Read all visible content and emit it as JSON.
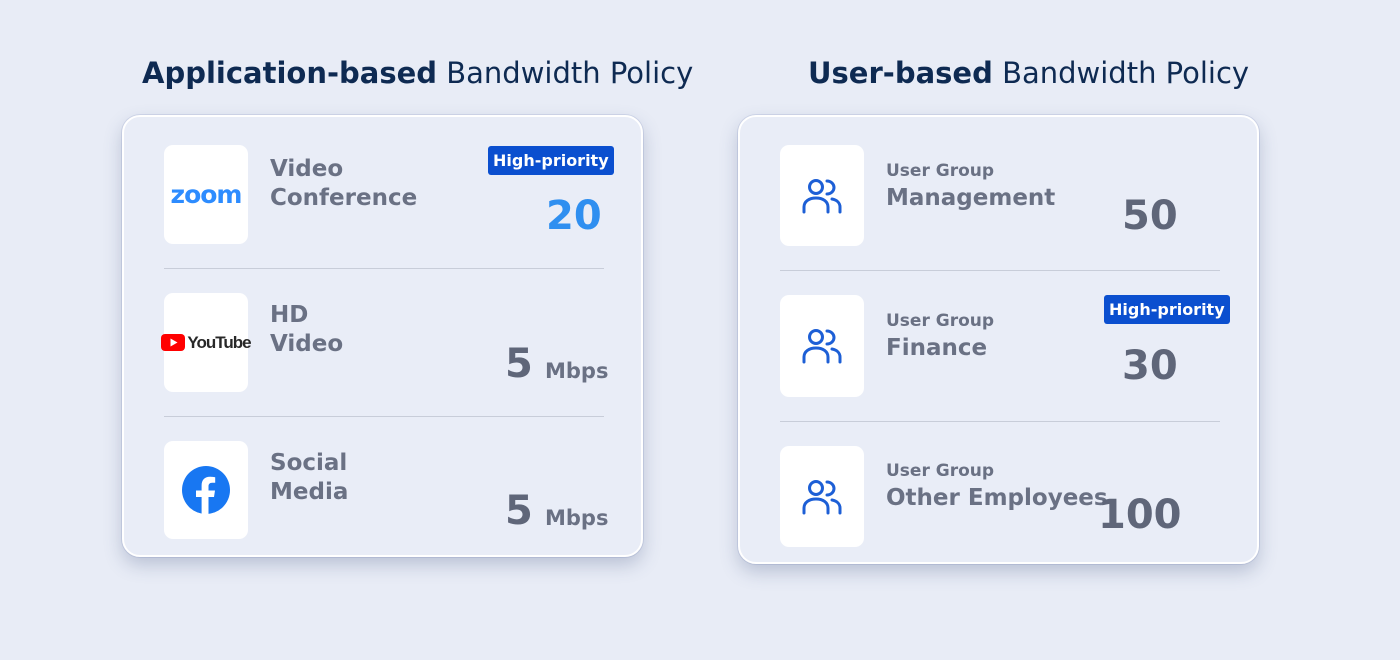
{
  "app_policy": {
    "title_bold": "Application-based",
    "title_normal": "Bandwidth Policy",
    "rows": [
      {
        "logo": "zoom-logo",
        "logo_text": "zoom",
        "label_line1": "Video",
        "label_line2": "Conference",
        "badge": "High-priority",
        "value": "20",
        "unit": ""
      },
      {
        "logo": "youtube-logo",
        "logo_text": "YouTube",
        "label_line1": "HD",
        "label_line2": "Video",
        "badge": "",
        "value": "5",
        "unit": "Mbps"
      },
      {
        "logo": "facebook-logo",
        "logo_text": "",
        "label_line1": "Social",
        "label_line2": "Media",
        "badge": "",
        "value": "5",
        "unit": "Mbps"
      }
    ]
  },
  "user_policy": {
    "title_bold": "User-based",
    "title_normal": "Bandwidth Policy",
    "rows": [
      {
        "icon": "user-group-icon",
        "sublabel": "User Group",
        "label": "Management",
        "badge": "",
        "value": "50"
      },
      {
        "icon": "user-group-icon",
        "sublabel": "User Group",
        "label": "Finance",
        "badge": "High-priority",
        "value": "30"
      },
      {
        "icon": "user-group-icon",
        "sublabel": "User Group",
        "label": "Other Employees",
        "badge": "",
        "value": "100"
      }
    ]
  },
  "colors": {
    "background": "#e8ecf6",
    "title": "#0e2a52",
    "badge": "#0b4fcf",
    "accent_value": "#2f8ff0",
    "value": "#5f6679",
    "icon_blue": "#1d5fd6",
    "zoom_blue": "#2d8cff",
    "youtube_red": "#ff0000",
    "facebook_blue": "#1877f2"
  }
}
